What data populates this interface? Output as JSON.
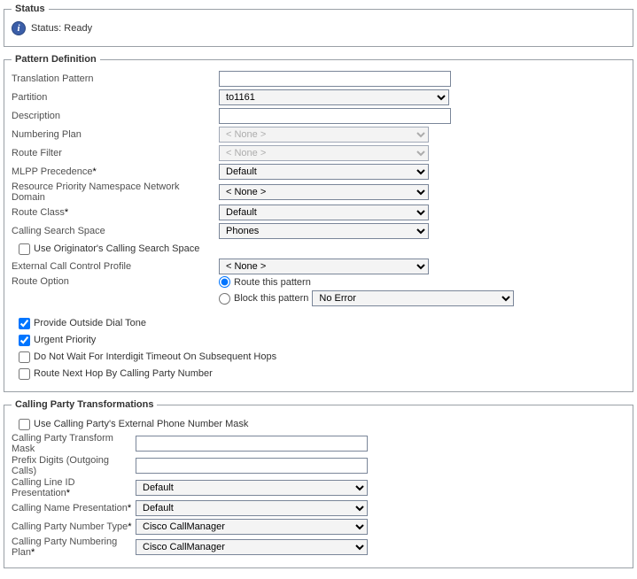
{
  "status": {
    "legend": "Status",
    "text": "Status: Ready"
  },
  "pattern": {
    "legend": "Pattern Definition",
    "translation_pattern": {
      "label": "Translation Pattern",
      "value": ""
    },
    "partition": {
      "label": "Partition",
      "value": "to1161"
    },
    "description": {
      "label": "Description",
      "value": ""
    },
    "numbering_plan": {
      "label": "Numbering Plan",
      "value": "< None >"
    },
    "route_filter": {
      "label": "Route Filter",
      "value": "< None >"
    },
    "mlpp": {
      "label": "MLPP Precedence",
      "value": "Default"
    },
    "rpnnd": {
      "label": "Resource Priority Namespace Network Domain",
      "value": "< None >"
    },
    "route_class": {
      "label": "Route Class",
      "value": "Default"
    },
    "css": {
      "label": "Calling Search Space",
      "value": "Phones"
    },
    "use_originator_css": {
      "label": "Use Originator's Calling Search Space",
      "checked": false
    },
    "eccp": {
      "label": "External Call Control Profile",
      "value": "< None >"
    },
    "route_option": {
      "label": "Route Option",
      "route_label": "Route this pattern",
      "block_label": "Block this pattern",
      "block_reason": "No Error"
    },
    "provide_dial_tone": {
      "label": "Provide Outside Dial Tone",
      "checked": true
    },
    "urgent_priority": {
      "label": "Urgent Priority",
      "checked": true
    },
    "no_wait_interdigit": {
      "label": "Do Not Wait For Interdigit Timeout On Subsequent Hops",
      "checked": false
    },
    "route_next_hop": {
      "label": "Route Next Hop By Calling Party Number",
      "checked": false
    }
  },
  "calling_party": {
    "legend": "Calling Party Transformations",
    "use_ext_mask": {
      "label": "Use Calling Party's External Phone Number Mask",
      "checked": false
    },
    "transform_mask": {
      "label": "Calling Party Transform Mask",
      "value": ""
    },
    "prefix_digits": {
      "label": "Prefix Digits (Outgoing Calls)",
      "value": ""
    },
    "clid_presentation": {
      "label": "Calling Line ID Presentation",
      "value": "Default"
    },
    "name_presentation": {
      "label": "Calling Name Presentation",
      "value": "Default"
    },
    "number_type": {
      "label": "Calling Party Number Type",
      "value": "Cisco CallManager"
    },
    "numbering_plan": {
      "label": "Calling Party Numbering Plan",
      "value": "Cisco CallManager"
    }
  },
  "req_mark": "*"
}
